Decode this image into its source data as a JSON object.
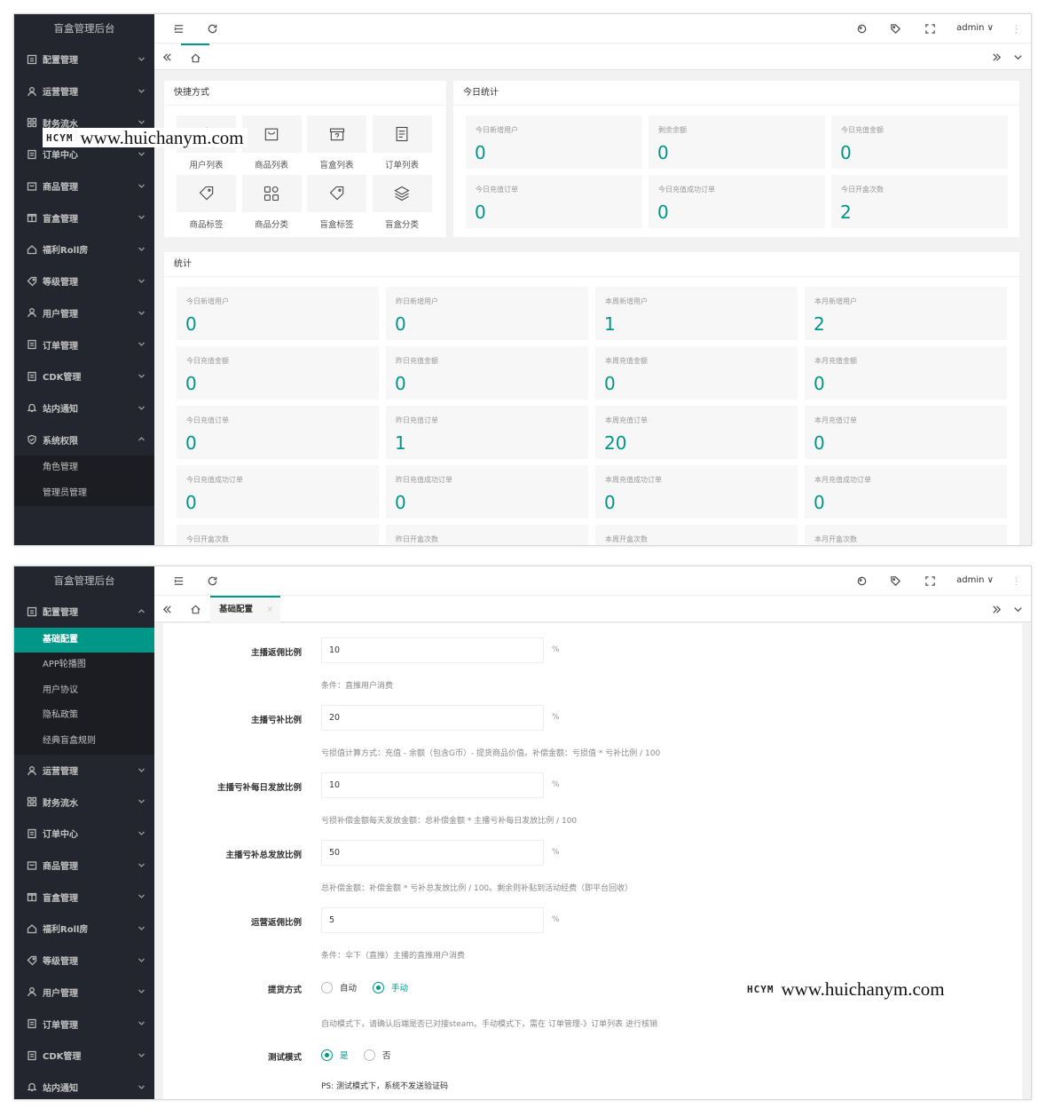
{
  "app_title": "盲盒管理后台",
  "user": "admin",
  "watermark": {
    "logo": "HCYM",
    "url": "www.huichanym.com"
  },
  "panel1": {
    "nav": [
      "配置管理",
      "运营管理",
      "财务流水",
      "订单中心",
      "商品管理",
      "盲盒管理",
      "福利Roll房",
      "等级管理",
      "用户管理",
      "订单管理",
      "CDK管理",
      "站内通知",
      "系统权限"
    ],
    "sub": [
      "角色管理",
      "管理员管理"
    ],
    "quick_title": "快捷方式",
    "quick": [
      "用户列表",
      "商品列表",
      "盲盒列表",
      "订单列表",
      "商品标签",
      "商品分类",
      "盲盒标签",
      "盲盒分类"
    ],
    "today_title": "今日统计",
    "today": [
      {
        "label": "今日新增用户",
        "value": "0"
      },
      {
        "label": "剩余余额",
        "value": "0"
      },
      {
        "label": "今日充值金额",
        "value": "0"
      },
      {
        "label": "今日充值订单",
        "value": "0"
      },
      {
        "label": "今日充值成功订单",
        "value": "0"
      },
      {
        "label": "今日开盒次数",
        "value": "2"
      }
    ],
    "stats_title": "统计",
    "stats": [
      [
        {
          "label": "今日新增用户",
          "value": "0"
        },
        {
          "label": "昨日新增用户",
          "value": "0"
        },
        {
          "label": "本周新增用户",
          "value": "1"
        },
        {
          "label": "本月新增用户",
          "value": "2"
        }
      ],
      [
        {
          "label": "今日充值金额",
          "value": "0"
        },
        {
          "label": "昨日充值金额",
          "value": "0"
        },
        {
          "label": "本周充值金额",
          "value": "0"
        },
        {
          "label": "本月充值金额",
          "value": "0"
        }
      ],
      [
        {
          "label": "今日充值订单",
          "value": "0"
        },
        {
          "label": "昨日充值订单",
          "value": "1"
        },
        {
          "label": "本周充值订单",
          "value": "20"
        },
        {
          "label": "本月充值订单",
          "value": "0"
        }
      ],
      [
        {
          "label": "今日充值成功订单",
          "value": "0"
        },
        {
          "label": "昨日充值成功订单",
          "value": "0"
        },
        {
          "label": "本周充值成功订单",
          "value": "0"
        },
        {
          "label": "本月充值成功订单",
          "value": "0"
        }
      ],
      [
        {
          "label": "今日开盒次数",
          "value": ""
        },
        {
          "label": "昨日开盒次数",
          "value": ""
        },
        {
          "label": "本周开盒次数",
          "value": ""
        },
        {
          "label": "本月开盒次数",
          "value": ""
        }
      ]
    ]
  },
  "panel2": {
    "nav_top": "配置管理",
    "sub": [
      "基础配置",
      "APP轮播图",
      "用户协议",
      "隐私政策",
      "经典盲盒规则"
    ],
    "nav": [
      "运营管理",
      "财务流水",
      "订单中心",
      "商品管理",
      "盲盒管理",
      "福利Roll房",
      "等级管理",
      "用户管理",
      "订单管理",
      "CDK管理",
      "站内通知"
    ],
    "tab": "基础配置",
    "tab_close": "×",
    "fields": [
      {
        "label": "主播返佣比例",
        "value": "10",
        "unit": "%",
        "hint": "条件：直推用户消费"
      },
      {
        "label": "主播亏补比例",
        "value": "20",
        "unit": "%",
        "hint": "亏损值计算方式：充值 - 余额（包含G币）- 提货商品价值。补偿金额：亏损值 * 亏补比例 / 100"
      },
      {
        "label": "主播亏补每日发放比例",
        "value": "10",
        "unit": "%",
        "hint": "亏损补偿金额每天发放金额：总补偿金额 * 主播亏补每日发放比例 / 100"
      },
      {
        "label": "主播亏补总发放比例",
        "value": "50",
        "unit": "%",
        "hint": "总补偿金额：补偿金额 * 亏补总发放比例 / 100。剩余则补贴到活动经费（即平台回收）"
      },
      {
        "label": "运营返佣比例",
        "value": "5",
        "unit": "%",
        "hint": "条件：伞下（直推）主播的直推用户消费"
      }
    ],
    "delivery": {
      "label": "提货方式",
      "opt1": "自动",
      "opt2": "手动",
      "hint": "自动模式下，请确认后端是否已对接steam。手动模式下，需在 订单管理-》订单列表 进行核销"
    },
    "test": {
      "label": "测试模式",
      "opt1": "是",
      "opt2": "否",
      "hint": "PS: 测试模式下，系统不发送验证码"
    }
  }
}
